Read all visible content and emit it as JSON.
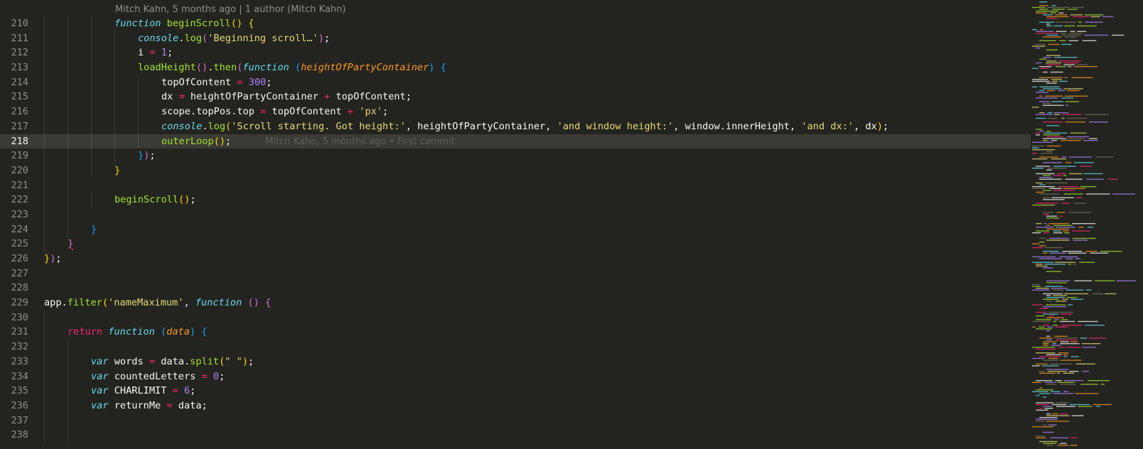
{
  "editor": {
    "codelens": "Mitch Kahn, 5 months ago | 1 author (Mitch Kahn)",
    "blame": "Mitch Kahn, 5 months ago • First commit",
    "current_line": 218
  },
  "lines": [
    {
      "n": "210",
      "indent": 3,
      "tokens": [
        [
          "kw",
          "function "
        ],
        [
          "fn",
          "beginScroll"
        ],
        [
          "b1",
          "()"
        ],
        [
          "plain",
          " "
        ],
        [
          "b1",
          "{"
        ]
      ]
    },
    {
      "n": "211",
      "indent": 4,
      "tokens": [
        [
          "kw",
          "console"
        ],
        [
          "plain",
          "."
        ],
        [
          "fn",
          "log"
        ],
        [
          "b2",
          "("
        ],
        [
          "str",
          "'Beginning scroll…'"
        ],
        [
          "b2",
          ")"
        ],
        [
          "plain",
          ";"
        ]
      ]
    },
    {
      "n": "212",
      "indent": 4,
      "tokens": [
        [
          "plain",
          "i "
        ],
        [
          "op",
          "="
        ],
        [
          "plain",
          " "
        ],
        [
          "num",
          "1"
        ],
        [
          "plain",
          ";"
        ]
      ]
    },
    {
      "n": "213",
      "indent": 4,
      "tokens": [
        [
          "fn",
          "loadHeight"
        ],
        [
          "b2",
          "()"
        ],
        [
          "plain",
          "."
        ],
        [
          "fn",
          "then"
        ],
        [
          "b2",
          "("
        ],
        [
          "kw",
          "function "
        ],
        [
          "b3",
          "("
        ],
        [
          "param",
          "heightOfPartyContainer"
        ],
        [
          "b3",
          ")"
        ],
        [
          "plain",
          " "
        ],
        [
          "b3",
          "{"
        ]
      ]
    },
    {
      "n": "214",
      "indent": 5,
      "tokens": [
        [
          "plain",
          "topOfContent "
        ],
        [
          "op",
          "="
        ],
        [
          "plain",
          " "
        ],
        [
          "num",
          "300"
        ],
        [
          "plain",
          ";"
        ]
      ]
    },
    {
      "n": "215",
      "indent": 5,
      "tokens": [
        [
          "plain",
          "dx "
        ],
        [
          "op",
          "="
        ],
        [
          "plain",
          " heightOfPartyContainer "
        ],
        [
          "op",
          "+"
        ],
        [
          "plain",
          " topOfContent;"
        ]
      ]
    },
    {
      "n": "216",
      "indent": 5,
      "tokens": [
        [
          "plain",
          "scope.topPos.top "
        ],
        [
          "op",
          "="
        ],
        [
          "plain",
          " topOfContent "
        ],
        [
          "op",
          "+"
        ],
        [
          "plain",
          " "
        ],
        [
          "str",
          "'px'"
        ],
        [
          "plain",
          ";"
        ]
      ]
    },
    {
      "n": "217",
      "indent": 5,
      "tokens": [
        [
          "kw",
          "console"
        ],
        [
          "plain",
          "."
        ],
        [
          "fn",
          "log"
        ],
        [
          "b1",
          "("
        ],
        [
          "str",
          "'Scroll starting. Got height:'"
        ],
        [
          "plain",
          ", heightOfPartyContainer, "
        ],
        [
          "str",
          "'and window height:'"
        ],
        [
          "plain",
          ", window.innerHeight, "
        ],
        [
          "str",
          "'and dx:'"
        ],
        [
          "plain",
          ", dx"
        ],
        [
          "b1",
          ")"
        ],
        [
          "plain",
          ";"
        ]
      ]
    },
    {
      "n": "218",
      "indent": 5,
      "blame": true,
      "tokens": [
        [
          "fn",
          "outerLoop"
        ],
        [
          "b1",
          "()"
        ],
        [
          "plain",
          ";"
        ]
      ]
    },
    {
      "n": "219",
      "indent": 4,
      "tokens": [
        [
          "b3",
          "}"
        ],
        [
          "b2",
          ")"
        ],
        [
          "plain",
          ";"
        ]
      ]
    },
    {
      "n": "220",
      "indent": 3,
      "tokens": [
        [
          "b1",
          "}"
        ]
      ]
    },
    {
      "n": "221",
      "indent": 2,
      "tokens": []
    },
    {
      "n": "222",
      "indent": 3,
      "tokens": [
        [
          "fn",
          "beginScroll"
        ],
        [
          "b1",
          "()"
        ],
        [
          "plain",
          ";"
        ]
      ]
    },
    {
      "n": "223",
      "indent": 2,
      "tokens": []
    },
    {
      "n": "224",
      "indent": 2,
      "tokens": [
        [
          "b3",
          "}"
        ]
      ]
    },
    {
      "n": "225",
      "indent": 1,
      "tokens": [
        [
          "b2 err",
          "}"
        ]
      ]
    },
    {
      "n": "226",
      "indent": 0,
      "tokens": [
        [
          "b1",
          "}"
        ],
        [
          "b2",
          ")"
        ],
        [
          "plain",
          ";"
        ]
      ]
    },
    {
      "n": "227",
      "indent": 0,
      "tokens": []
    },
    {
      "n": "228",
      "indent": 0,
      "tokens": []
    },
    {
      "n": "229",
      "indent": 0,
      "tokens": [
        [
          "plain",
          "app."
        ],
        [
          "fn",
          "filter"
        ],
        [
          "b1",
          "("
        ],
        [
          "str",
          "'nameMaximum'"
        ],
        [
          "plain",
          ", "
        ],
        [
          "kw",
          "function "
        ],
        [
          "b2",
          "()"
        ],
        [
          "plain",
          " "
        ],
        [
          "b2",
          "{"
        ]
      ]
    },
    {
      "n": "230",
      "indent": 1,
      "tokens": []
    },
    {
      "n": "231",
      "indent": 1,
      "tokens": [
        [
          "ret",
          "return "
        ],
        [
          "kw",
          "function "
        ],
        [
          "b3",
          "("
        ],
        [
          "param",
          "data"
        ],
        [
          "b3",
          ")"
        ],
        [
          "plain",
          " "
        ],
        [
          "b3",
          "{"
        ]
      ]
    },
    {
      "n": "232",
      "indent": 2,
      "tokens": []
    },
    {
      "n": "233",
      "indent": 2,
      "tokens": [
        [
          "kw",
          "var "
        ],
        [
          "plain",
          "words "
        ],
        [
          "op",
          "="
        ],
        [
          "plain",
          " data."
        ],
        [
          "fn",
          "split"
        ],
        [
          "b1",
          "("
        ],
        [
          "str",
          "\" \""
        ],
        [
          "b1",
          ")"
        ],
        [
          "plain",
          ";"
        ]
      ]
    },
    {
      "n": "234",
      "indent": 2,
      "tokens": [
        [
          "kw",
          "var "
        ],
        [
          "plain",
          "countedLetters "
        ],
        [
          "op",
          "="
        ],
        [
          "plain",
          " "
        ],
        [
          "num",
          "0"
        ],
        [
          "plain",
          ";"
        ]
      ]
    },
    {
      "n": "235",
      "indent": 2,
      "tokens": [
        [
          "kw",
          "var "
        ],
        [
          "plain",
          "CHARLIMIT "
        ],
        [
          "op",
          "="
        ],
        [
          "plain",
          " "
        ],
        [
          "num",
          "6"
        ],
        [
          "plain",
          ";"
        ]
      ]
    },
    {
      "n": "236",
      "indent": 2,
      "tokens": [
        [
          "kw",
          "var "
        ],
        [
          "plain",
          "returnMe "
        ],
        [
          "op",
          "="
        ],
        [
          "plain",
          " data;"
        ]
      ]
    },
    {
      "n": "237",
      "indent": 2,
      "tokens": []
    },
    {
      "n": "238",
      "indent": 2,
      "tokens": []
    }
  ],
  "colors": {
    "background": "#23241f",
    "keyword": "#66d9ef",
    "function": "#a6e22e",
    "string": "#e6db74",
    "number": "#ae81ff",
    "operator": "#f92672"
  }
}
